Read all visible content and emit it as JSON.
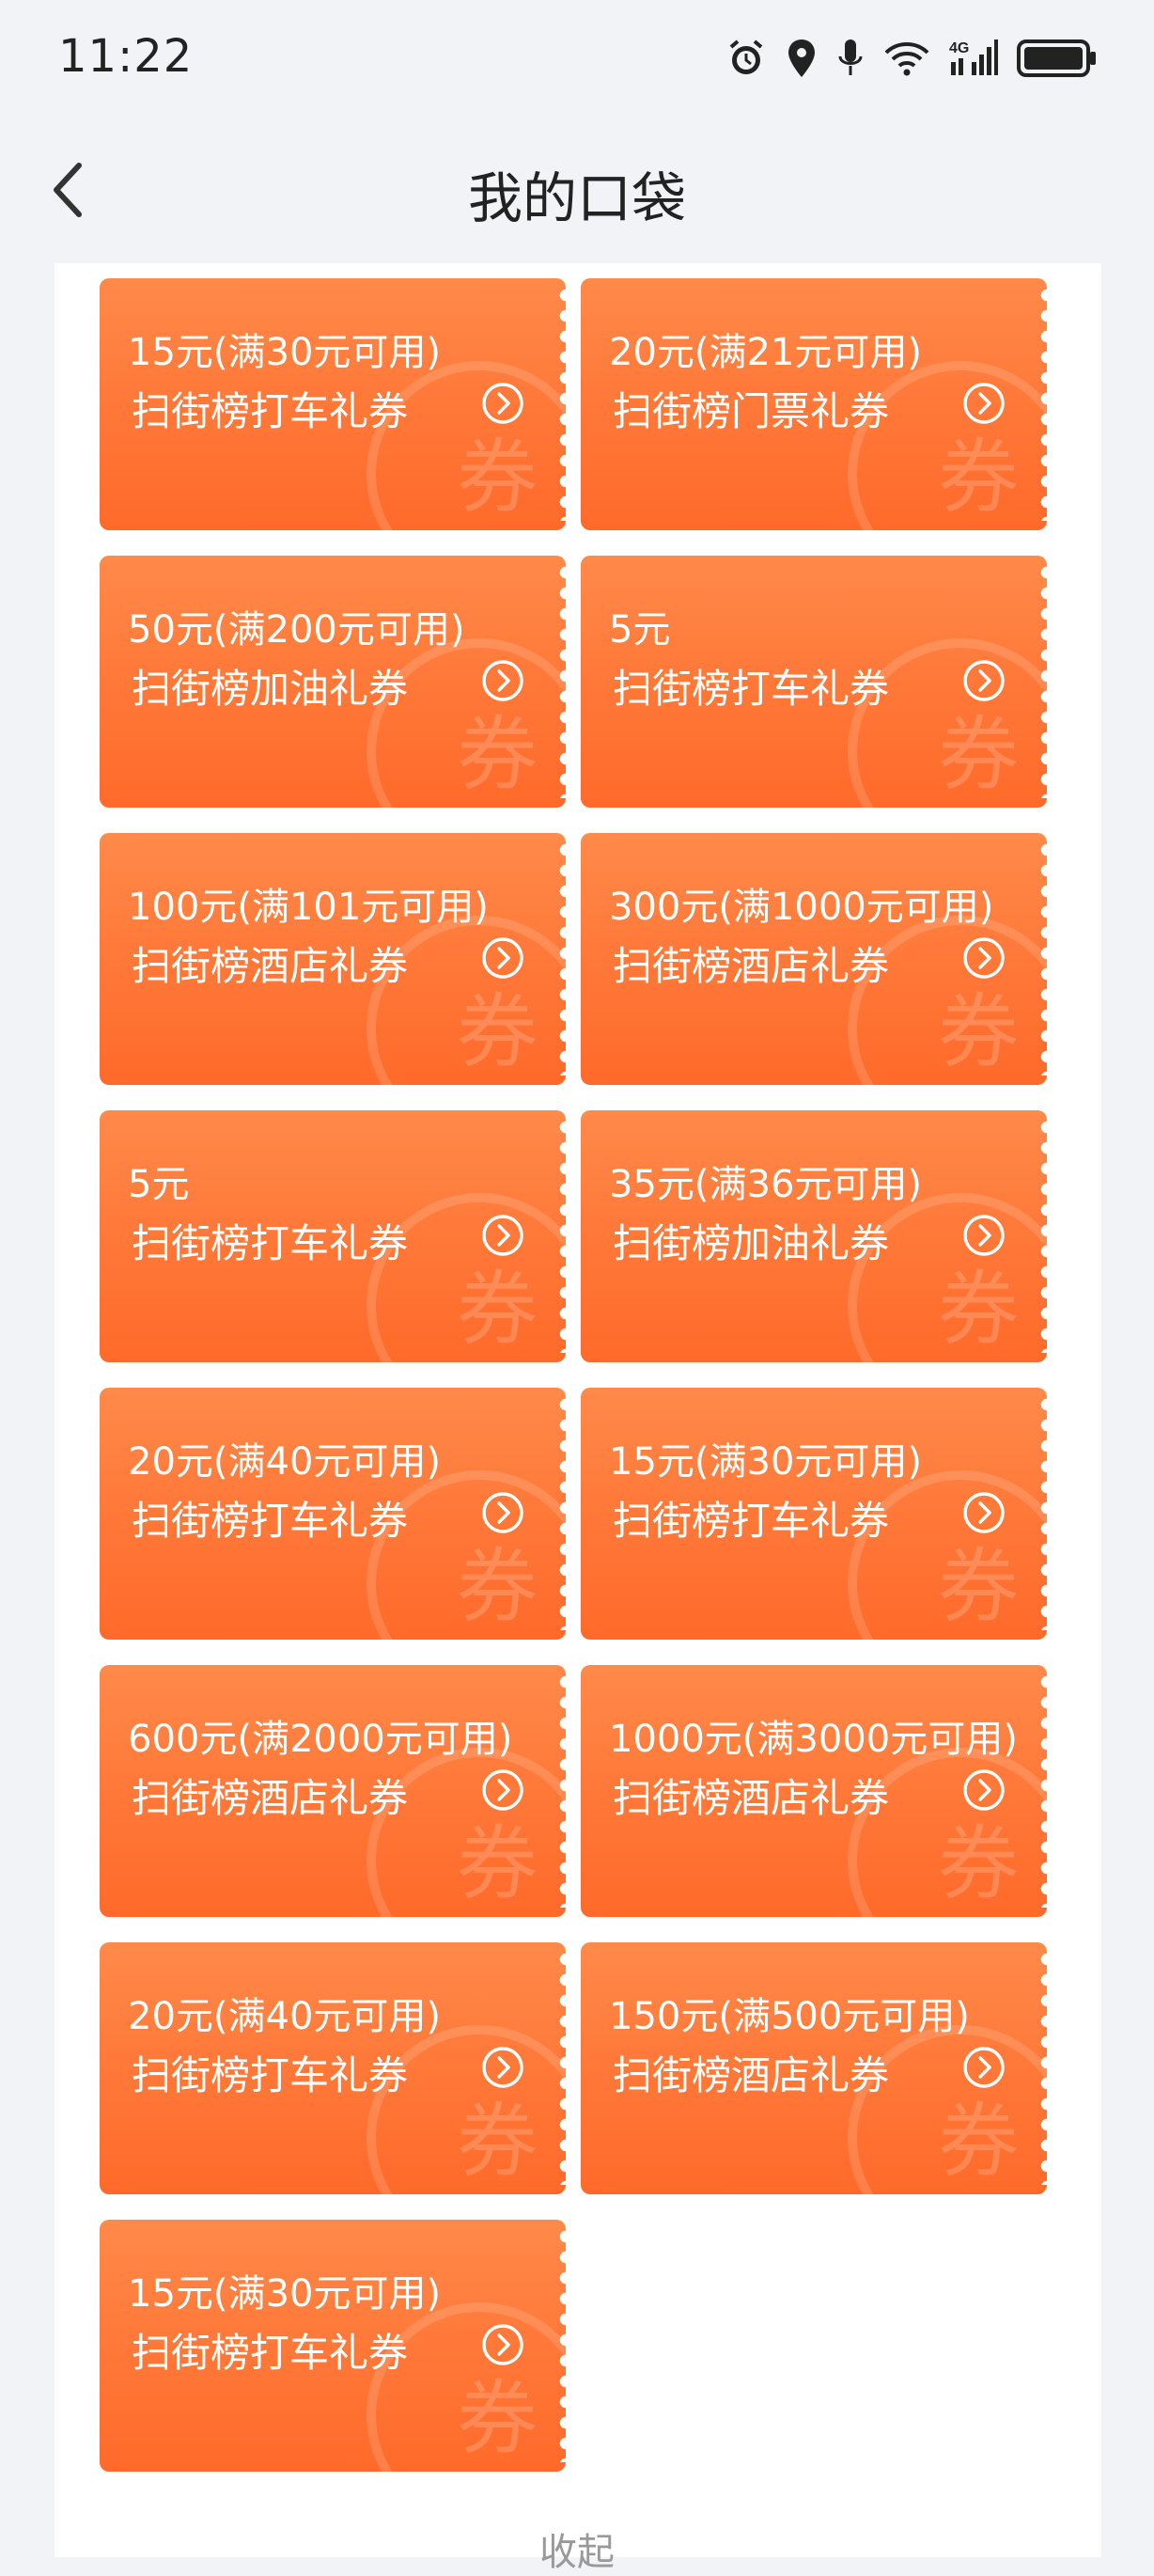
{
  "status_bar": {
    "time": "11:22",
    "icons": [
      "alarm-icon",
      "location-icon",
      "microphone-icon",
      "wifi-icon",
      "signal-4g-icon",
      "battery-icon"
    ],
    "network_label": "4G"
  },
  "nav": {
    "title": "我的口袋",
    "back_icon": "chevron-left-icon"
  },
  "coupon_watermark": "券",
  "coupons": [
    {
      "amount": "15元(满30元可用)",
      "name": "扫街榜打车礼券"
    },
    {
      "amount": "20元(满21元可用)",
      "name": "扫街榜门票礼券"
    },
    {
      "amount": "50元(满200元可用)",
      "name": "扫街榜加油礼券"
    },
    {
      "amount": "5元",
      "name": "扫街榜打车礼券"
    },
    {
      "amount": "100元(满101元可用)",
      "name": "扫街榜酒店礼券"
    },
    {
      "amount": "300元(满1000元可用)",
      "name": "扫街榜酒店礼券"
    },
    {
      "amount": "5元",
      "name": "扫街榜打车礼券"
    },
    {
      "amount": "35元(满36元可用)",
      "name": "扫街榜加油礼券"
    },
    {
      "amount": "20元(满40元可用)",
      "name": "扫街榜打车礼券"
    },
    {
      "amount": "15元(满30元可用)",
      "name": "扫街榜打车礼券"
    },
    {
      "amount": "600元(满2000元可用)",
      "name": "扫街榜酒店礼券"
    },
    {
      "amount": "1000元(满3000元可用)",
      "name": "扫街榜酒店礼券"
    },
    {
      "amount": "20元(满40元可用)",
      "name": "扫街榜打车礼券"
    },
    {
      "amount": "150元(满500元可用)",
      "name": "扫街榜酒店礼券"
    },
    {
      "amount": "15元(满30元可用)",
      "name": "扫街榜打车礼券"
    }
  ],
  "colors": {
    "coupon_top": "#ff8a4a",
    "coupon_bottom": "#ff6a2a",
    "background": "#f2f3f7"
  },
  "footer": {
    "collapse_label": "收起"
  }
}
